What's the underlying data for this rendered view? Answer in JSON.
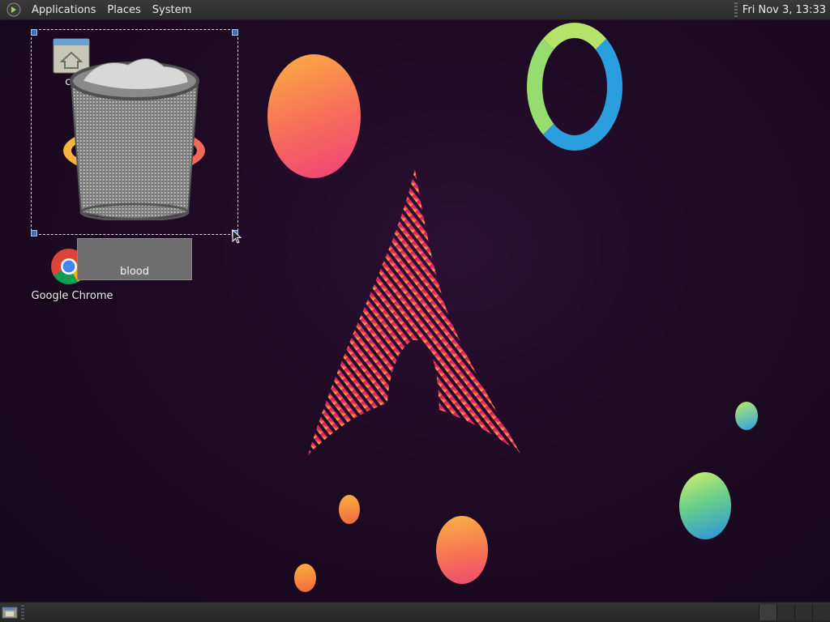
{
  "top_panel": {
    "menus": [
      "Applications",
      "Places",
      "System"
    ],
    "clock": "Fri Nov 3, 13:33"
  },
  "desktop": {
    "icons": {
      "home": {
        "label": "cu",
        "icon": "home-folder-icon"
      },
      "trash": {
        "icon": "trash-icon"
      },
      "chrome": {
        "label": "Google Chrome",
        "icon": "chrome-icon"
      }
    },
    "rename_field_value": "blood"
  },
  "bottom_panel": {
    "workspaces": 4
  },
  "colors": {
    "panel_bg": "#2c2c2c",
    "desktop_bg": "#1e0a24",
    "selection_handle": "#3f6fb5",
    "arch_pink": "#e0246a",
    "arch_yellow": "#f4c23a"
  }
}
